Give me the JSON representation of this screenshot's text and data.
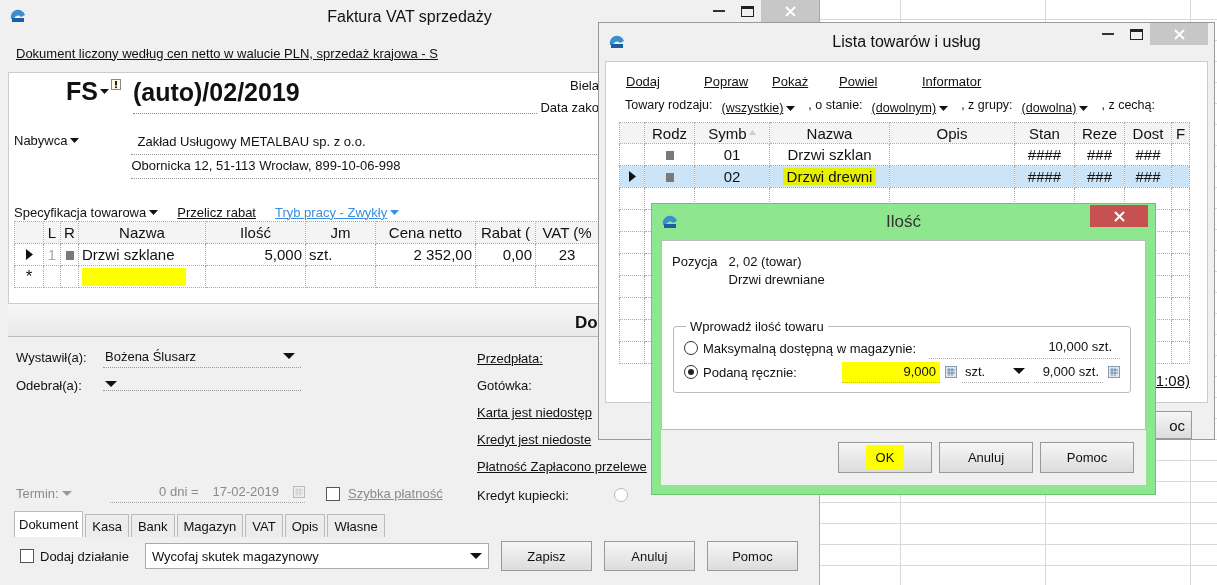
{
  "main_window": {
    "title": "Faktura VAT sprzedaży",
    "info_link": "Dokument liczony według cen netto w walucie PLN, sprzedaż krajowa - S",
    "doc_type": "FS",
    "doc_number": "(auto)/02/2019",
    "place_label": "Biela",
    "date_label": "Data zako",
    "buyer_label": "Nabywca",
    "buyer_name": "Zakład Usługowy METALBAU sp. z o.o.",
    "buyer_address": "Obornicka 12, 51-113 Wrocław, 899-10-06-998",
    "toolbar": [
      {
        "label": "Specyfikacja towarowa",
        "kind": "menu"
      },
      {
        "label": "Przelicz rabat",
        "kind": "link"
      },
      {
        "label": "Tryb pracy - Zwykły",
        "kind": "mode"
      }
    ],
    "items_table": {
      "columns": [
        "L",
        "R",
        "Nazwa",
        "Ilość",
        "Jm",
        "Cena netto",
        "Rabat (",
        "VAT (%"
      ],
      "rows": [
        {
          "current": true,
          "lp": "1",
          "name": "Drzwi szklane",
          "qty": "5,000",
          "unit": "szt.",
          "price": "2 352,00",
          "discount": "0,00",
          "vat": "23"
        }
      ],
      "new_row": {
        "marker": "*",
        "highlighted": true
      }
    },
    "section_heading": "Do",
    "issued_by_label": "Wystawił(a):",
    "issued_by": "Bożena Ślusarz",
    "received_by_label": "Odebrał(a):",
    "payments": [
      {
        "label": "Przedpłata:",
        "kind": "link"
      },
      {
        "label": "Gotówka:",
        "kind": "label"
      },
      {
        "label": "Karta jest niedostęp",
        "kind": "link"
      },
      {
        "label": "Kredyt jest niedoste",
        "kind": "link"
      },
      {
        "label": "Płatność Zapłacono przelewe",
        "kind": "link"
      },
      {
        "label": "Kredyt kupiecki:",
        "kind": "radio",
        "selected": false
      }
    ],
    "term_label": "Termin:",
    "term_days": "0 dni =",
    "term_date": "17-02-2019",
    "quick_payment": {
      "label": "Szybka płatność",
      "checked": false
    },
    "tabs": [
      {
        "label": "Dokument",
        "selected": true
      },
      {
        "label": "Kasa",
        "selected": false
      },
      {
        "label": "Bank",
        "selected": false
      },
      {
        "label": "Magazyn",
        "selected": false
      },
      {
        "label": "VAT",
        "selected": false
      },
      {
        "label": "Opis",
        "selected": false
      },
      {
        "label": "Własne",
        "selected": false
      }
    ],
    "add_action": {
      "label": "Dodaj działanie",
      "checked": false
    },
    "action_select": "Wycofaj skutek magazynowy",
    "buttons": [
      "Zapisz",
      "Anuluj",
      "Pomoc"
    ]
  },
  "list_window": {
    "title": "Lista towarów i usług",
    "actions": [
      "Dodaj",
      "Popraw",
      "Pokaż",
      "Powiel",
      "Informator"
    ],
    "filters": [
      {
        "label": "Towary rodzaju:",
        "value": "(wszystkie)"
      },
      {
        "label": ", o stanie:",
        "value": "(dowolnym)"
      },
      {
        "label": ", z grupy:",
        "value": "(dowolna)"
      },
      {
        "label": ", z cechą:"
      }
    ],
    "columns": [
      "Rodz",
      "Symb",
      "Nazwa",
      "Opis",
      "Stan",
      "Reze",
      "Dost",
      "F"
    ],
    "rows": [
      {
        "selected": false,
        "highlighted": false,
        "symbol": "01",
        "name": "Drzwi szklan",
        "stock": "####",
        "reserved": "###",
        "available": "###"
      },
      {
        "selected": true,
        "highlighted": true,
        "symbol": "02",
        "name": "Drzwi drewni",
        "stock": "####",
        "reserved": "###",
        "available": "###"
      }
    ],
    "footer_link": "1:08)",
    "footer_button": "oc"
  },
  "dialog": {
    "title": "Ilość",
    "position_label": "Pozycja",
    "position": "2, 02 (towar)",
    "item_name": "Drzwi drewniane",
    "group_label": "Wprowadź ilość towaru",
    "options": [
      {
        "kind": "readonly",
        "label": "Maksymalną dostępną w magazynie:",
        "selected": false,
        "result": "10,000 szt."
      },
      {
        "kind": "input",
        "label": "Podaną ręcznie:",
        "selected": true,
        "value": "9,000",
        "highlighted": true,
        "unit": "szt.",
        "result": "9,000 szt."
      }
    ],
    "buttons": [
      {
        "label": "OK",
        "highlighted": true
      },
      {
        "label": "Anuluj",
        "highlighted": false
      },
      {
        "label": "Pomoc",
        "highlighted": false
      }
    ]
  }
}
